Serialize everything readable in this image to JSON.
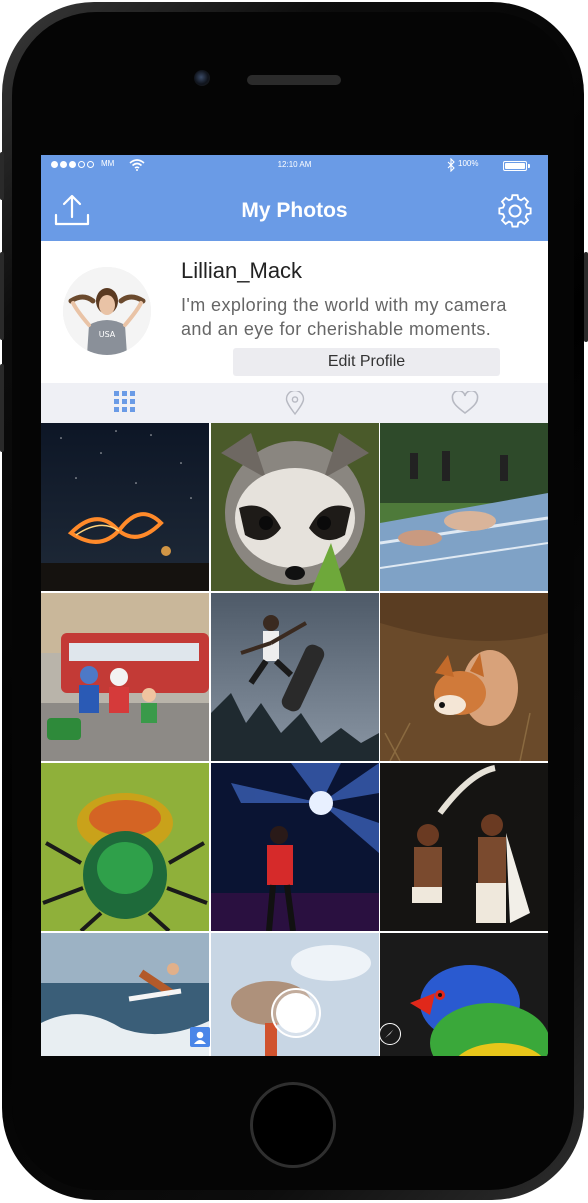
{
  "status_bar": {
    "carrier": "MM",
    "time": "12:10 AM",
    "battery_percent": "100%",
    "signal_bars_filled": 3,
    "signal_bars_total": 5
  },
  "nav": {
    "title": "My Photos",
    "left_icon": "upload-icon",
    "right_icon": "gear-icon"
  },
  "profile": {
    "username": "Lillian_Mack",
    "bio_line1": "I'm exploring the world with my camera",
    "bio_line2": "and an eye for cherishable moments.",
    "edit_button": "Edit Profile"
  },
  "tabs": [
    {
      "icon": "grid-icon",
      "active": true
    },
    {
      "icon": "location-pin-icon",
      "active": false
    },
    {
      "icon": "heart-icon",
      "active": false
    }
  ],
  "photos": [
    {
      "subject": "light painting under starry sky"
    },
    {
      "subject": "raccoon close-up"
    },
    {
      "subject": "people sliding on water slide"
    },
    {
      "subject": "toy figures with bus"
    },
    {
      "subject": "skateboarder jumping"
    },
    {
      "subject": "red fox in grass"
    },
    {
      "subject": "green beetle macro"
    },
    {
      "subject": "singer on stage with lights"
    },
    {
      "subject": "dancers with feathers"
    },
    {
      "subject": "surfer on wave"
    },
    {
      "subject": "fairground ride"
    },
    {
      "subject": "rainbow lorikeet parrot"
    }
  ],
  "overlay_icons": [
    "contact-icon",
    "capture-button-icon",
    "compass-icon"
  ],
  "colors": {
    "accent": "#6a9be6",
    "tab_bar": "#eff0f5",
    "edit_button_bg": "#ececf0"
  }
}
